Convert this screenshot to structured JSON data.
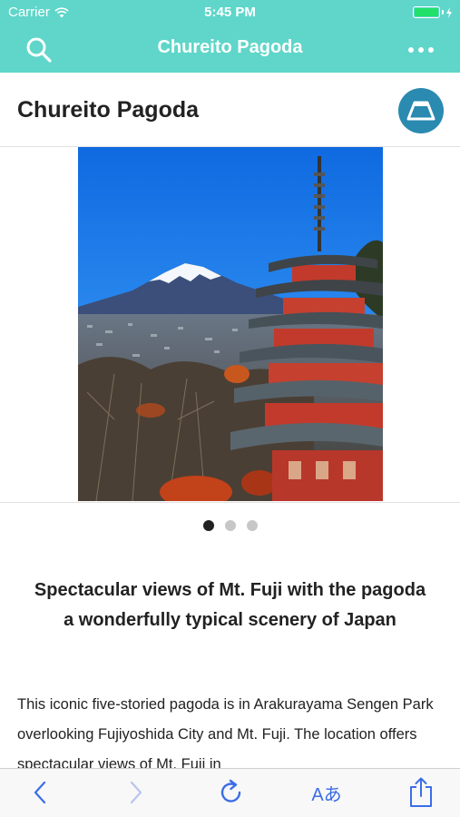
{
  "status_bar": {
    "carrier": "Carrier",
    "time": "5:45 PM"
  },
  "nav": {
    "title": "Chureito Pagoda",
    "search_icon": "search-icon",
    "more_icon": "more-icon"
  },
  "header": {
    "title": "Chureito Pagoda",
    "logo_icon": "mt-fuji-logo-icon"
  },
  "carousel": {
    "image_alt": "Chureito Pagoda with Mt. Fuji",
    "page_count": 3,
    "current_page": 1
  },
  "article": {
    "headline": "Spectacular views of Mt. Fuji with the pagoda a wonderfully typical scenery of Japan",
    "body": "This iconic five-storied pagoda is in Arakurayama Sengen Park overlooking Fujiyoshida City and Mt. Fuji. The location offers spectacular views of Mt. Fuji in"
  },
  "toolbar": {
    "text_size_label": "Aあ",
    "colors": {
      "active": "#3b6de8",
      "disabled": "#b8c6ee"
    }
  },
  "colors": {
    "brand": "#5fd6c9",
    "logo_bg": "#2a8ab0",
    "battery": "#22e06a"
  }
}
